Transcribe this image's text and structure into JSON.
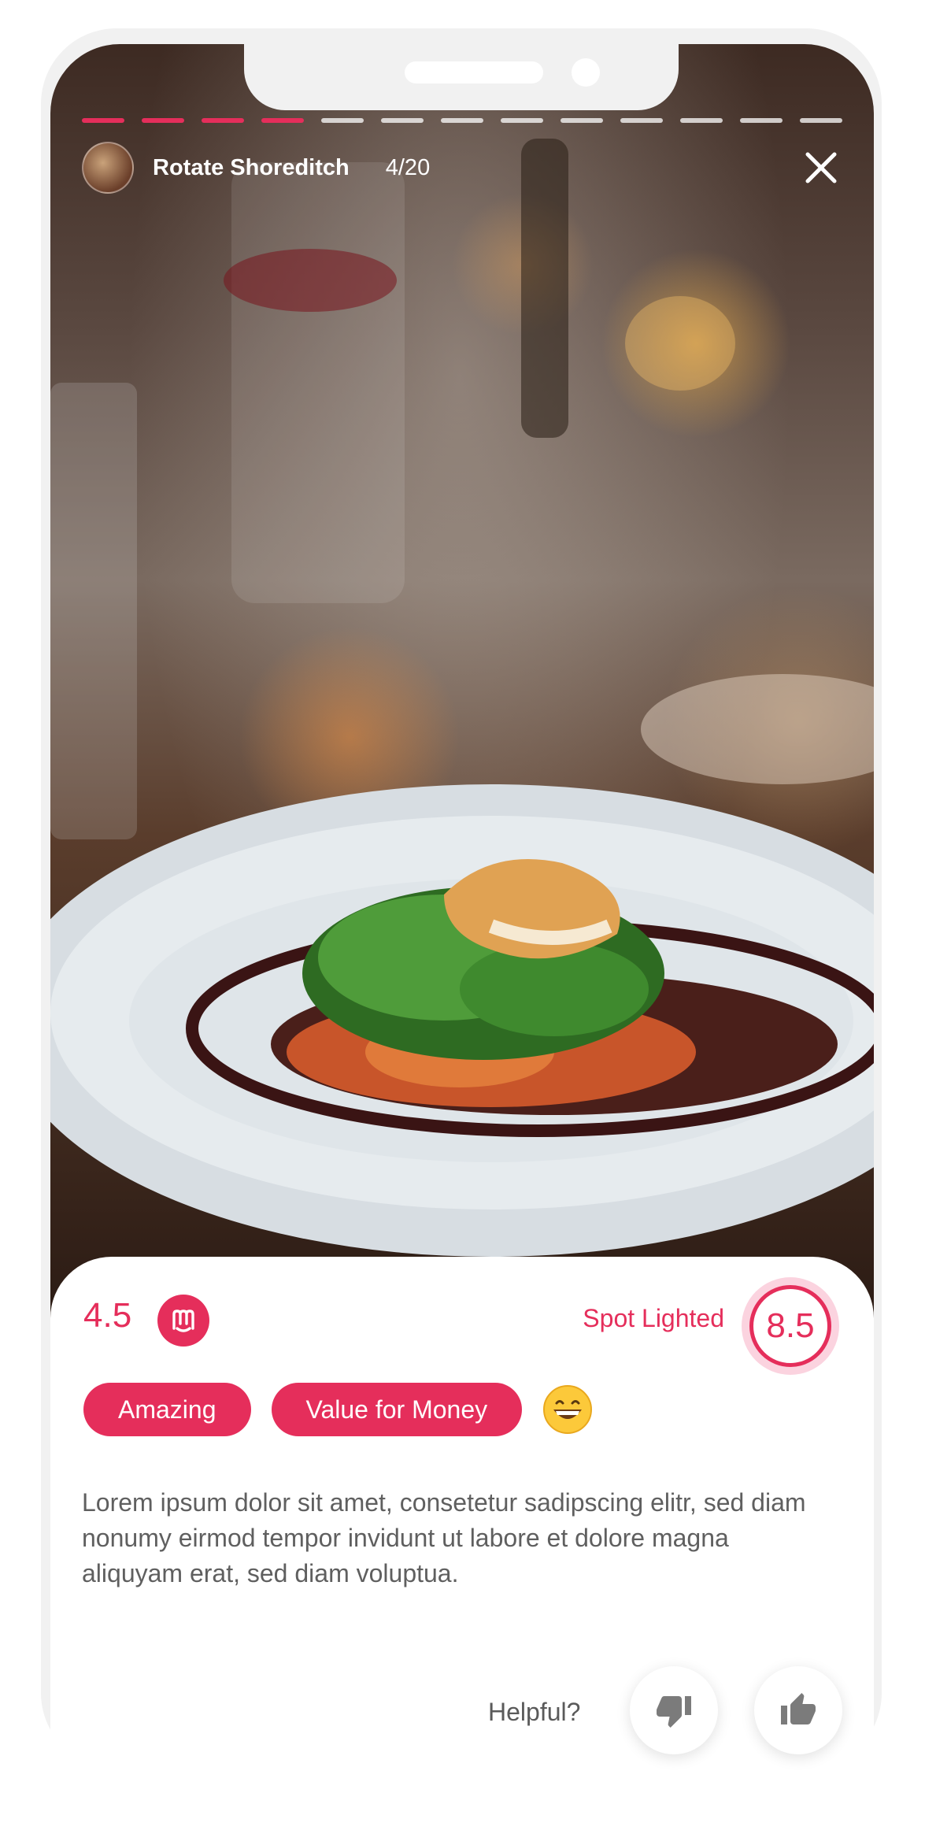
{
  "story": {
    "venue_name": "Rotate Shoreditch",
    "counter": "4/20",
    "progress": {
      "current": 4,
      "total": 20
    }
  },
  "review": {
    "rating": "4.5",
    "spot_label": "Spot Lighted",
    "spot_score": "8.5",
    "tags": [
      "Amazing",
      "Value for Money"
    ],
    "reaction_emoji": "grinning-face",
    "text": "Lorem ipsum dolor sit amet, consetetur sadipscing elitr, sed diam nonumy eirmod tempor invidunt ut labore et dolore magna aliquyam erat, sed diam voluptua."
  },
  "feedback": {
    "label": "Helpful?",
    "thumbs_down_icon": "thumbs-down-icon",
    "thumbs_up_icon": "thumbs-up-icon"
  },
  "colors": {
    "accent": "#e52e5b",
    "accent_light": "#fbd3df",
    "body_text": "#5f5f5f"
  }
}
